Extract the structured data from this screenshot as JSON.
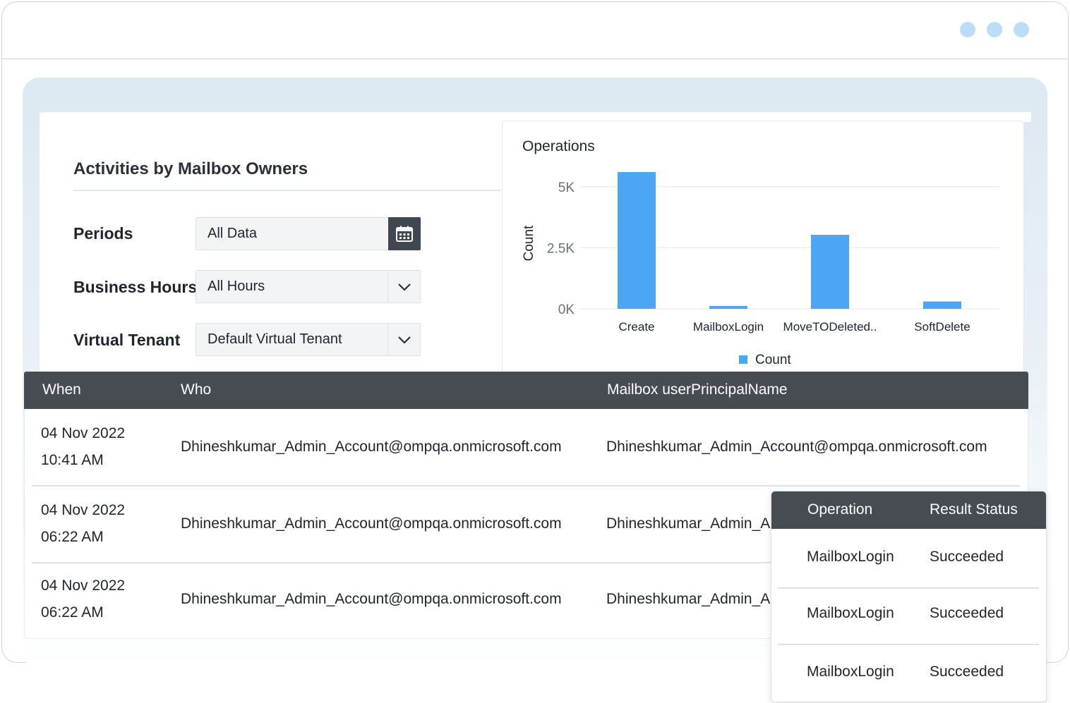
{
  "window": {
    "controls": [
      "dot-1",
      "dot-2",
      "dot-3"
    ],
    "control_color": "#bcdcf7"
  },
  "panel": {
    "title": "Activities by Mailbox Owners",
    "filters": [
      {
        "label": "Periods",
        "value": "All Data",
        "control": "calendar-icon"
      },
      {
        "label": "Business Hours",
        "value": "All Hours",
        "control": "chevron-down-icon"
      },
      {
        "label": "Virtual Tenant",
        "value": "Default Virtual Tenant",
        "control": "chevron-down-icon"
      }
    ]
  },
  "chart_data": {
    "type": "bar",
    "title": "Operations",
    "xlabel": "",
    "ylabel": "Count",
    "categories": [
      "Create",
      "MailboxLogin",
      "MoveTODeleted..",
      "SoftDelete"
    ],
    "series": [
      {
        "name": "Count",
        "values": [
          5600,
          120,
          3030,
          300
        ],
        "color": "#4da5f5"
      }
    ],
    "ylim": [
      0,
      5600
    ],
    "yticks": [
      {
        "value": 0,
        "label": "0K"
      },
      {
        "value": 2500,
        "label": "2.5K"
      },
      {
        "value": 5000,
        "label": "5K"
      }
    ],
    "grid": true,
    "legend": "bottom-center"
  },
  "table": {
    "columns": [
      "When",
      "Who",
      "Mailbox userPrincipalName"
    ],
    "rows": [
      {
        "date": "04 Nov 2022",
        "time": "10:41 AM",
        "who": "Dhineshkumar_Admin_Account@ompqa.onmicrosoft.com",
        "upn": "Dhineshkumar_Admin_Account@ompqa.onmicrosoft.com"
      },
      {
        "date": "04 Nov 2022",
        "time": "06:22 AM",
        "who": "Dhineshkumar_Admin_Account@ompqa.onmicrosoft.com",
        "upn": "Dhineshkumar_Admin_A"
      },
      {
        "date": "04 Nov 2022",
        "time": "06:22 AM",
        "who": "Dhineshkumar_Admin_Account@ompqa.onmicrosoft.com",
        "upn": "Dhineshkumar_Admin_A"
      }
    ]
  },
  "popover": {
    "columns": [
      "Operation",
      "Result Status"
    ],
    "rows": [
      {
        "operation": "MailboxLogin",
        "status": "Succeeded"
      },
      {
        "operation": "MailboxLogin",
        "status": "Succeeded"
      },
      {
        "operation": "MailboxLogin",
        "status": "Succeeded"
      }
    ]
  }
}
